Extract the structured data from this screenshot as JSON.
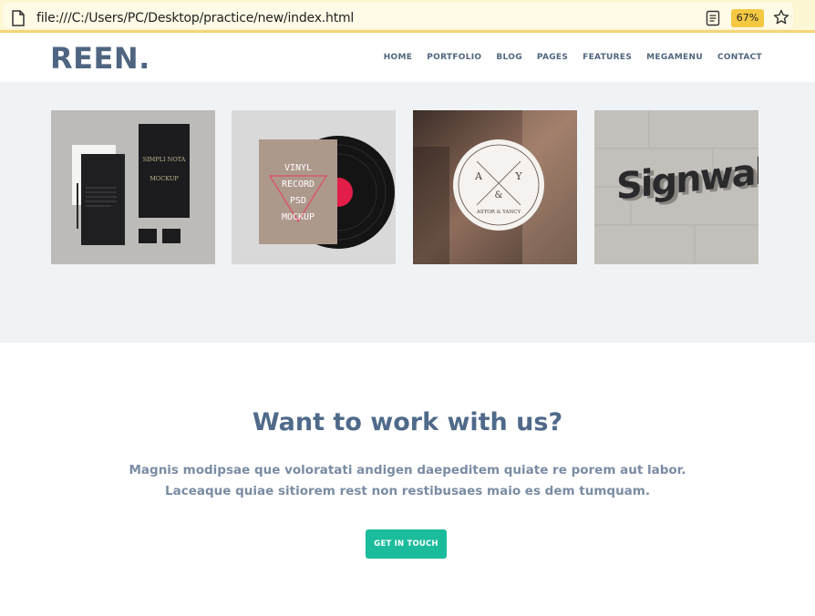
{
  "browser": {
    "url": "file:///C:/Users/PC/Desktop/practice/new/index.html",
    "zoom": "67%"
  },
  "header": {
    "logo": "REEN.",
    "nav": [
      "HOME",
      "PORTFOLIO",
      "BLOG",
      "PAGES",
      "FEATURES",
      "MEGAMENU",
      "CONTACT"
    ]
  },
  "portfolio": {
    "items": [
      {
        "name": "stationery-mockup",
        "texts": [
          "SIMPLI NOTA",
          "MOCKUP"
        ]
      },
      {
        "name": "vinyl-record-mockup",
        "texts": [
          "VINYL",
          "RECORD",
          "PSD",
          "MOCKUP"
        ]
      },
      {
        "name": "window-sign",
        "texts": [
          "A",
          "Y",
          "&",
          "ASTOR & YANCY"
        ]
      },
      {
        "name": "signwall",
        "texts": [
          "Signwall"
        ]
      }
    ]
  },
  "cta": {
    "title": "Want to work with us?",
    "line1": "Magnis modipsae que voloratati andigen daepeditem quiate re porem aut labor.",
    "line2": "Laceaque quiae sitiorem rest non restibusaes maio es dem tumquam.",
    "button": "GET IN TOUCH"
  },
  "colors": {
    "accent": "#1abc9c",
    "heading": "#4f6a8a",
    "band": "#f0f3f6"
  }
}
